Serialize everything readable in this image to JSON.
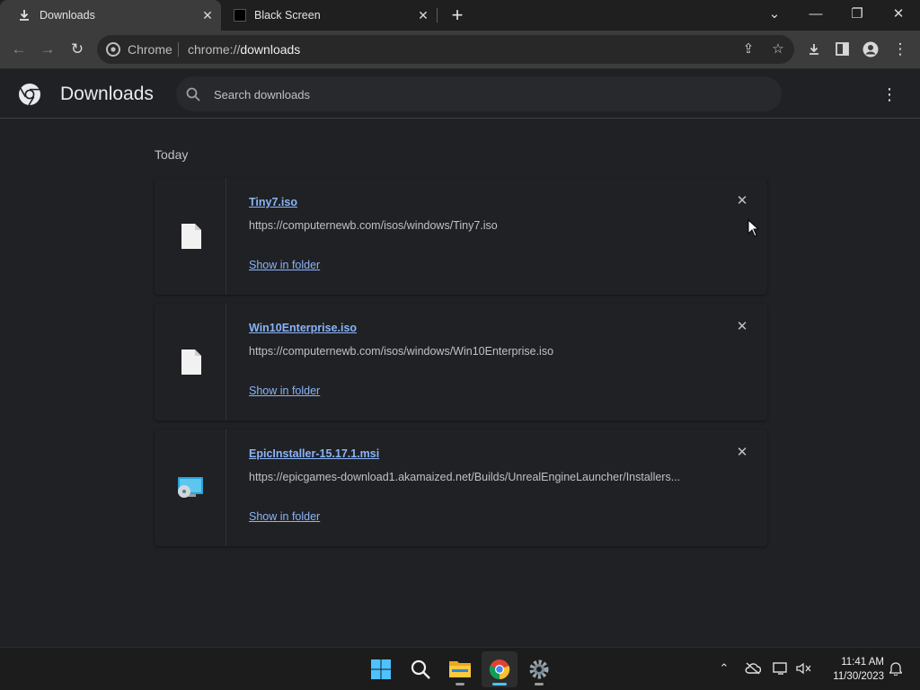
{
  "tabs": [
    {
      "title": "Downloads",
      "active": true,
      "icon": "download-icon"
    },
    {
      "title": "Black Screen",
      "active": false,
      "icon": "black-square-favicon"
    }
  ],
  "omnibox": {
    "site_label": "Chrome",
    "url_scheme": "chrome://",
    "url_host": "downloads"
  },
  "page": {
    "title": "Downloads",
    "search_placeholder": "Search downloads"
  },
  "section_label": "Today",
  "downloads": [
    {
      "name": "Tiny7.iso",
      "url": "https://computernewb.com/isos/windows/Tiny7.iso",
      "action": "Show in folder",
      "icon": "file-icon"
    },
    {
      "name": "Win10Enterprise.iso",
      "url": "https://computernewb.com/isos/windows/Win10Enterprise.iso",
      "action": "Show in folder",
      "icon": "file-icon"
    },
    {
      "name": "EpicInstaller-15.17.1.msi",
      "url": "https://epicgames-download1.akamaized.net/Builds/UnrealEngineLauncher/Installers...",
      "action": "Show in folder",
      "icon": "installer-icon"
    }
  ],
  "clock": {
    "time": "11:41 AM",
    "date": "11/30/2023"
  },
  "colors": {
    "link": "#8ab4f8",
    "background": "#202124",
    "accent": "#4cc2ff"
  }
}
